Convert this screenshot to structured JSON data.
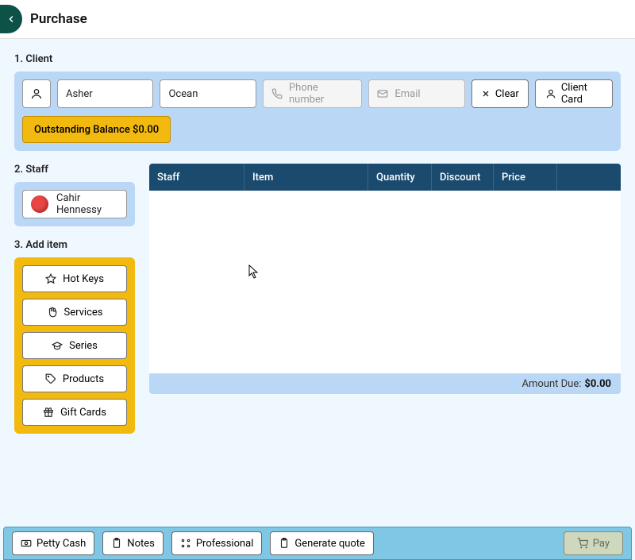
{
  "header": {
    "title": "Purchase"
  },
  "client": {
    "section_title": "1. Client",
    "first_name": "Asher",
    "last_name": "Ocean",
    "phone_placeholder": "Phone number",
    "email_placeholder": "Email",
    "clear_label": "Clear",
    "client_card_label": "Client Card",
    "outstanding_label": "Outstanding Balance $0.00"
  },
  "staff": {
    "section_title": "2. Staff",
    "name": "Cahir Hennessy"
  },
  "add_item": {
    "section_title": "3. Add item",
    "buttons": {
      "hotkeys": "Hot Keys",
      "services": "Services",
      "series": "Series",
      "products": "Products",
      "giftcards": "Gift Cards"
    }
  },
  "table": {
    "headers": {
      "staff": "Staff",
      "item": "Item",
      "quantity": "Quantity",
      "discount": "Discount",
      "price": "Price"
    },
    "footer_label": "Amount Due:",
    "footer_value": "$0.00"
  },
  "bottom": {
    "petty_cash": "Petty Cash",
    "notes": "Notes",
    "professional": "Professional",
    "generate_quote": "Generate quote",
    "pay": "Pay"
  }
}
